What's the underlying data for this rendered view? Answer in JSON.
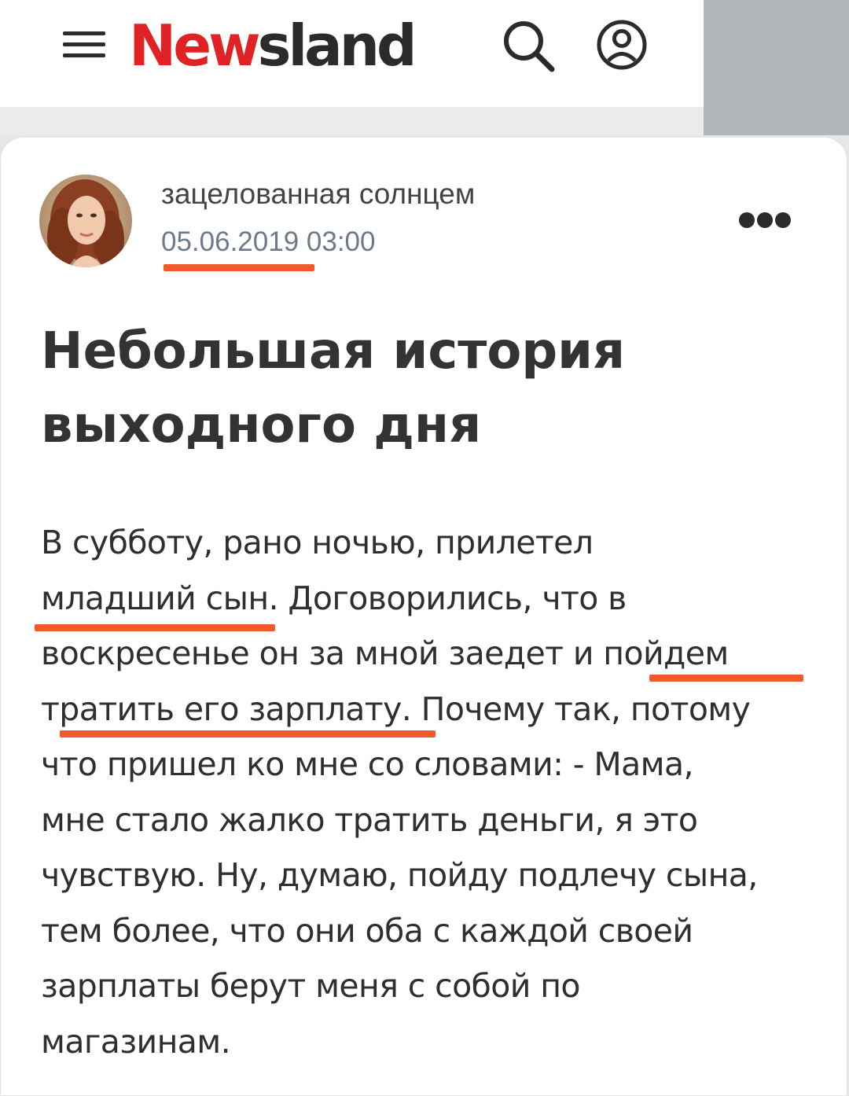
{
  "header": {
    "logo_part1": "New",
    "logo_part2": "sland",
    "icons": {
      "menu": "menu-icon",
      "search": "search-icon",
      "profile": "user-icon"
    },
    "colors": {
      "logo_red": "#e02224",
      "logo_dark": "#2b2b2b"
    }
  },
  "post": {
    "author": "зацелованная солнцем",
    "date": "05.06.2019 03:00",
    "title": "Небольшая история выходного дня",
    "body": [
      "В субботу, рано ночью,  прилетел",
      "младший сын. Договорились, что в",
      "воскресенье он за мной заедет и пойдем",
      "тратить его зарплату. Почему так, потому",
      "что пришел ко мне со словами: - Мама,",
      "мне стало жалко тратить деньги, я это",
      "чувствую. Ну, думаю, пойду подлечу сына,",
      "тем более, что они оба с каждой своей",
      "зарплаты берут меня с собой по",
      "магазинам."
    ],
    "more_icon": "more-dots-icon"
  },
  "annotations": {
    "underline_color": "#f25a2e"
  }
}
